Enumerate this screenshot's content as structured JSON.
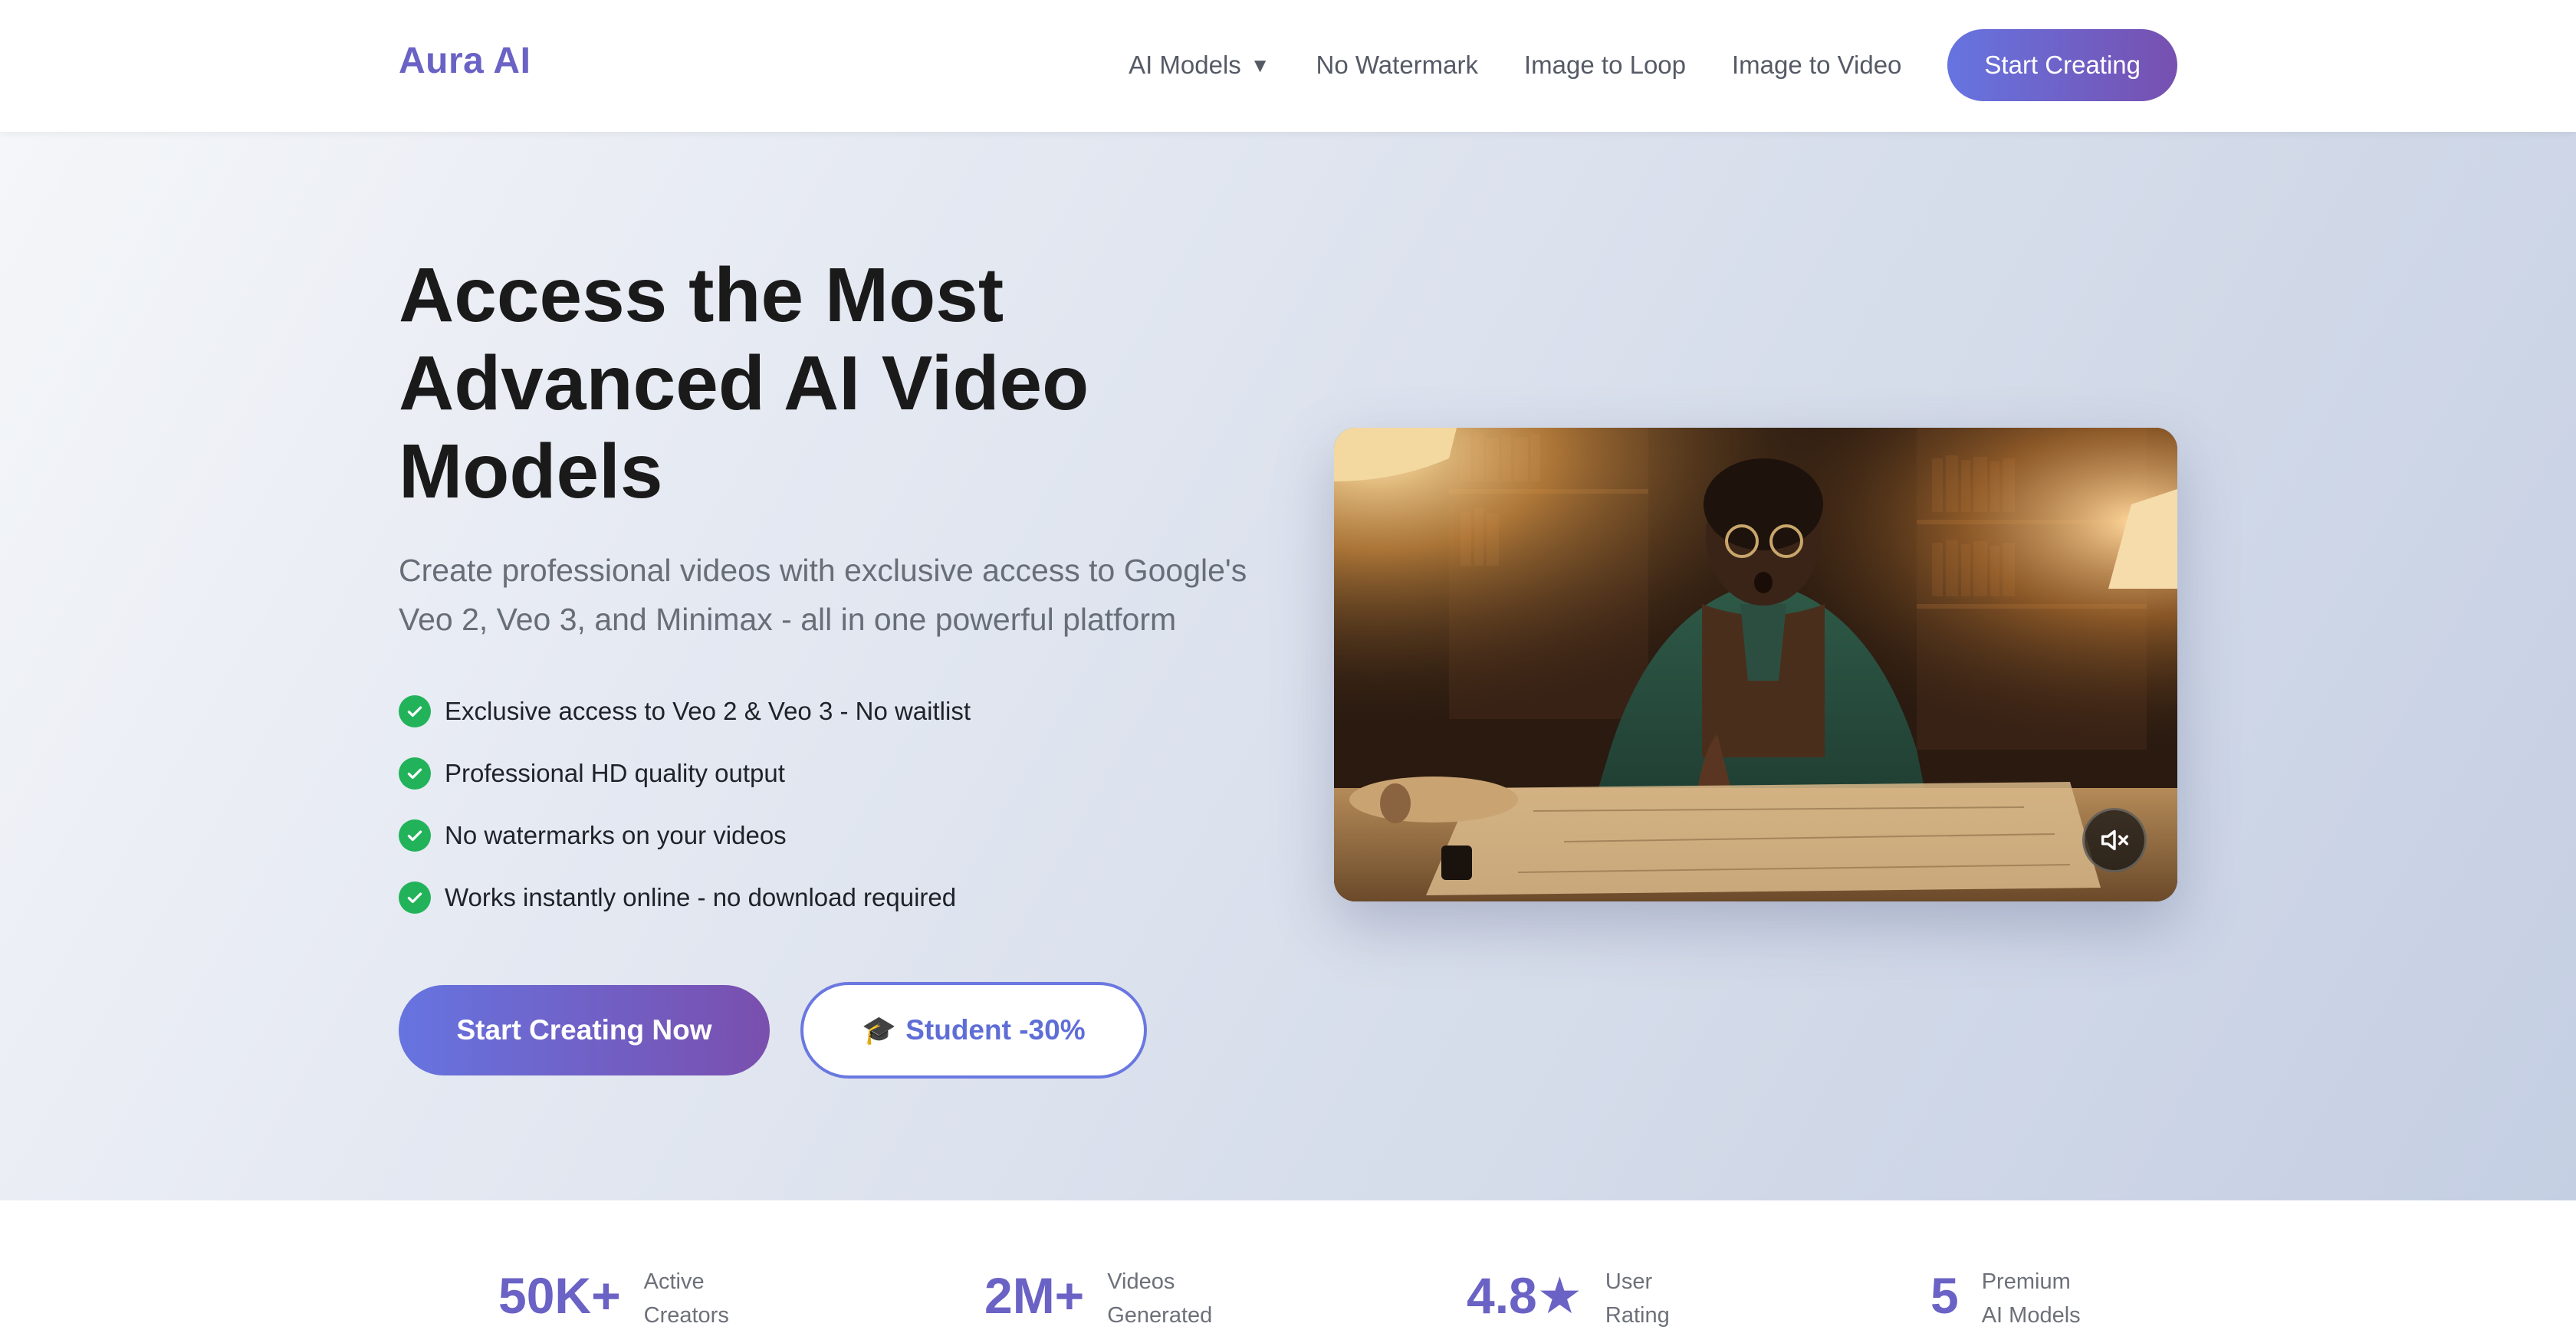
{
  "header": {
    "logo": "Aura AI",
    "nav": [
      {
        "label": "AI Models",
        "has_dropdown": true,
        "caret": "▼"
      },
      {
        "label": "No Watermark"
      },
      {
        "label": "Image to Loop"
      },
      {
        "label": "Image to Video"
      }
    ],
    "cta_label": "Start Creating"
  },
  "hero": {
    "title": "Access the Most Advanced AI Video Models",
    "subtitle": "Create professional videos with exclusive access to Google's Veo 2, Veo 3, and Minimax - all in one powerful platform",
    "features": [
      "Exclusive access to Veo 2 & Veo 3 - No waitlist",
      "Professional HD quality output",
      "No watermarks on your videos",
      "Works instantly online - no download required"
    ],
    "primary_button": "Start Creating Now",
    "secondary_button": {
      "icon": "🎓",
      "label": "Student -30%"
    }
  },
  "video": {
    "muted": true,
    "mute_icon": "speaker-muted-icon"
  },
  "stats": [
    {
      "value": "50K+",
      "label_line1": "Active",
      "label_line2": "Creators"
    },
    {
      "value": "2M+",
      "label_line1": "Videos",
      "label_line2": "Generated"
    },
    {
      "value": "4.8★",
      "label_line1": "User",
      "label_line2": "Rating"
    },
    {
      "value": "5",
      "label_line1": "Premium",
      "label_line2": "AI Models"
    }
  ],
  "colors": {
    "brand": "#6a62c4",
    "gradient_start": "#6674e0",
    "gradient_end": "#7750b0",
    "check": "#22b35a"
  }
}
